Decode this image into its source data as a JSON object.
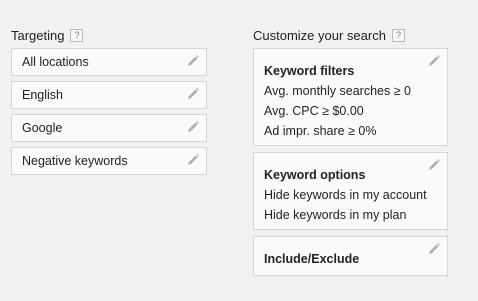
{
  "targeting": {
    "title": "Targeting",
    "help_glyph": "?",
    "items": [
      {
        "label": "All locations"
      },
      {
        "label": "English"
      },
      {
        "label": "Google"
      },
      {
        "label": "Negative keywords"
      }
    ],
    "edit_icon": "pencil-icon"
  },
  "customize": {
    "title": "Customize your search",
    "help_glyph": "?",
    "keyword_filters": {
      "heading": "Keyword filters",
      "lines": [
        "Avg. monthly searches ≥ 0",
        "Avg. CPC ≥ $0.00",
        "Ad impr. share ≥ 0%"
      ]
    },
    "keyword_options": {
      "heading": "Keyword options",
      "lines": [
        "Hide keywords in my account",
        "Hide keywords in my plan"
      ]
    },
    "include_exclude": {
      "heading": "Include/Exclude"
    }
  },
  "colors": {
    "background": "#f1f1f1",
    "card_bg": "#fafafa",
    "card_border": "#d6d6d6",
    "pencil": "#b0b0b0"
  }
}
